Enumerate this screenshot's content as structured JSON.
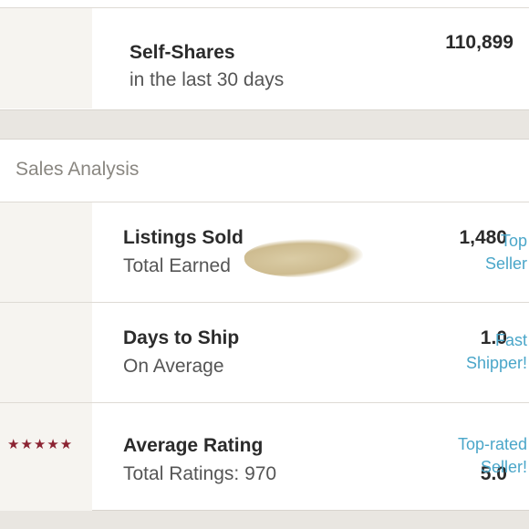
{
  "top_stat": {
    "value": "110,899",
    "title": "Self-Shares",
    "subtitle": "in the last 30 days"
  },
  "sales_analysis": {
    "section_title": "Sales Analysis",
    "rows": [
      {
        "value": "1,480",
        "title": "Listings Sold",
        "subtitle": "Total Earned",
        "badge_line1": "Top",
        "badge_line2": "Seller"
      },
      {
        "value": "1.0",
        "title": "Days to Ship",
        "subtitle": "On Average",
        "badge_line1": "Fast",
        "badge_line2": "Shipper!"
      },
      {
        "value": "5.0",
        "stars": "★★★★★",
        "title": "Average Rating",
        "subtitle": "Total Ratings: 970",
        "badge_line1": "Top-rated",
        "badge_line2": "Seller!"
      }
    ]
  },
  "colors": {
    "accent": "#4aa6c9",
    "star": "#8b2332",
    "panel": "#f6f4f0"
  }
}
